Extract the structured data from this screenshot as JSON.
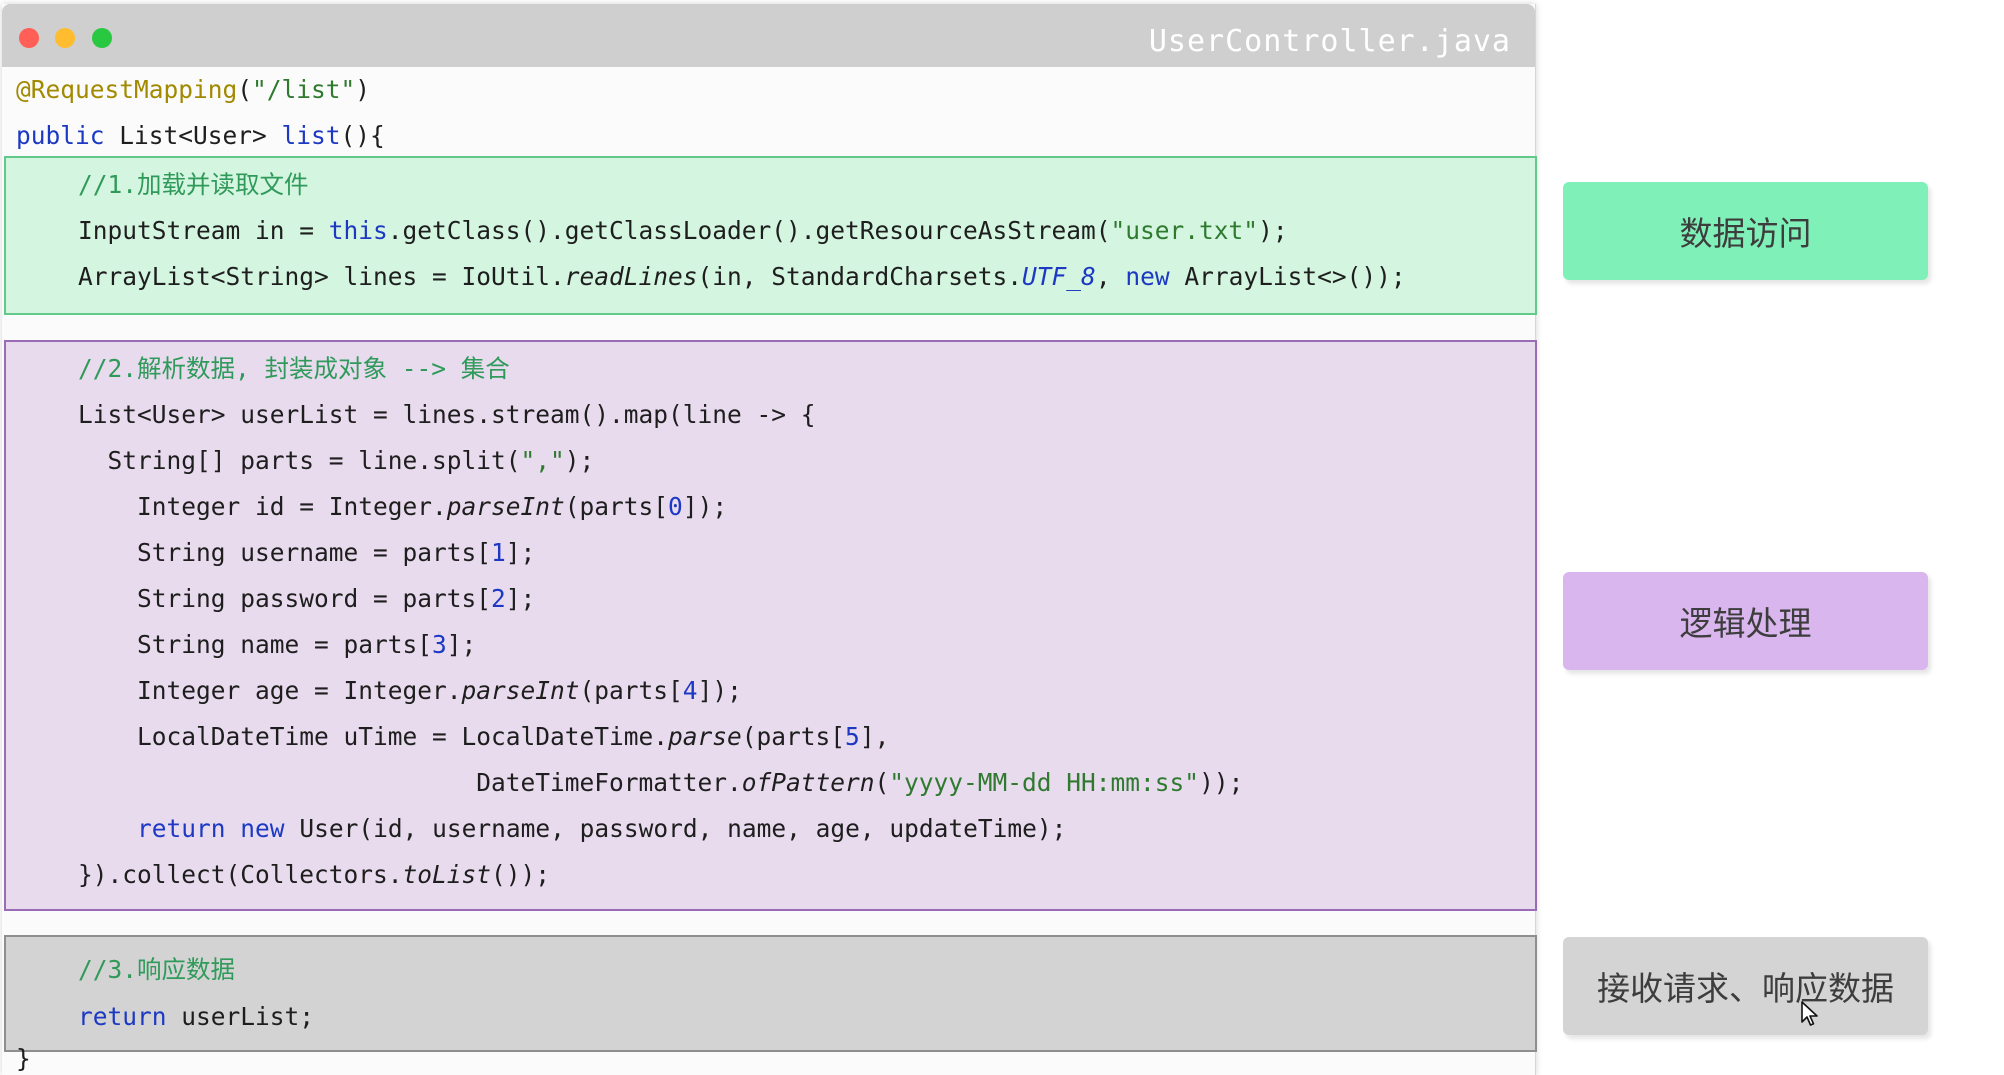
{
  "window": {
    "title": "UserController.java"
  },
  "code": {
    "header": [
      [
        {
          "t": "@RequestMapping",
          "c": "ann"
        },
        {
          "t": "(",
          "c": ""
        },
        {
          "t": "\"/list\"",
          "c": "str"
        },
        {
          "t": ")",
          "c": ""
        }
      ],
      [
        {
          "t": "public",
          "c": "kw"
        },
        {
          "t": " List<User> ",
          "c": ""
        },
        {
          "t": "list",
          "c": "kw"
        },
        {
          "t": "(){",
          "c": ""
        }
      ]
    ],
    "block1": [
      [
        {
          "t": "//1.加载并读取文件",
          "c": "cmt"
        }
      ],
      [
        {
          "t": "InputStream in = ",
          "c": ""
        },
        {
          "t": "this",
          "c": "kw"
        },
        {
          "t": ".getClass().getClassLoader().getResourceAsStream(",
          "c": ""
        },
        {
          "t": "\"user.txt\"",
          "c": "str"
        },
        {
          "t": ");",
          "c": ""
        }
      ],
      [
        {
          "t": "ArrayList<String> lines = IoUtil.",
          "c": ""
        },
        {
          "t": "readLines",
          "c": "it"
        },
        {
          "t": "(in, StandardCharsets.",
          "c": ""
        },
        {
          "t": "UTF_8",
          "c": "it kw"
        },
        {
          "t": ", ",
          "c": ""
        },
        {
          "t": "new",
          "c": "kw"
        },
        {
          "t": " ArrayList<>());",
          "c": ""
        }
      ]
    ],
    "block2": [
      [
        {
          "t": "//2.解析数据, 封装成对象 --> 集合",
          "c": "cmt"
        }
      ],
      [
        {
          "t": "List<User> userList = lines.stream().map(line -> {",
          "c": ""
        }
      ],
      [
        {
          "t": "  String[] parts = line.split(",
          "c": ""
        },
        {
          "t": "\",\"",
          "c": "str"
        },
        {
          "t": ");",
          "c": ""
        }
      ],
      [
        {
          "t": "    Integer id = Integer.",
          "c": ""
        },
        {
          "t": "parseInt",
          "c": "it"
        },
        {
          "t": "(parts[",
          "c": ""
        },
        {
          "t": "0",
          "c": "num"
        },
        {
          "t": "]);",
          "c": ""
        }
      ],
      [
        {
          "t": "    String username = parts[",
          "c": ""
        },
        {
          "t": "1",
          "c": "num"
        },
        {
          "t": "];",
          "c": ""
        }
      ],
      [
        {
          "t": "    String password = parts[",
          "c": ""
        },
        {
          "t": "2",
          "c": "num"
        },
        {
          "t": "];",
          "c": ""
        }
      ],
      [
        {
          "t": "    String name = parts[",
          "c": ""
        },
        {
          "t": "3",
          "c": "num"
        },
        {
          "t": "];",
          "c": ""
        }
      ],
      [
        {
          "t": "    Integer age = Integer.",
          "c": ""
        },
        {
          "t": "parseInt",
          "c": "it"
        },
        {
          "t": "(parts[",
          "c": ""
        },
        {
          "t": "4",
          "c": "num"
        },
        {
          "t": "]);",
          "c": ""
        }
      ],
      [
        {
          "t": "    LocalDateTime uTime = LocalDateTime.",
          "c": ""
        },
        {
          "t": "parse",
          "c": "it"
        },
        {
          "t": "(parts[",
          "c": ""
        },
        {
          "t": "5",
          "c": "num"
        },
        {
          "t": "],",
          "c": ""
        }
      ],
      [
        {
          "t": "                           DateTimeFormatter.",
          "c": ""
        },
        {
          "t": "ofPattern",
          "c": "it"
        },
        {
          "t": "(",
          "c": ""
        },
        {
          "t": "\"yyyy-MM-dd HH:mm:ss\"",
          "c": "str"
        },
        {
          "t": "));",
          "c": ""
        }
      ],
      [
        {
          "t": "    ",
          "c": ""
        },
        {
          "t": "return",
          "c": "kw"
        },
        {
          "t": " ",
          "c": ""
        },
        {
          "t": "new",
          "c": "kw"
        },
        {
          "t": " User(id, username, password, name, age, updateTime);",
          "c": ""
        }
      ],
      [
        {
          "t": "}).collect(Collectors.",
          "c": ""
        },
        {
          "t": "toList",
          "c": "it"
        },
        {
          "t": "());",
          "c": ""
        }
      ]
    ],
    "block3": [
      [
        {
          "t": "//3.响应数据",
          "c": "cmt"
        }
      ],
      [
        {
          "t": "return",
          "c": "kw"
        },
        {
          "t": " userList;",
          "c": ""
        }
      ]
    ],
    "footer": [
      [
        {
          "t": "}",
          "c": ""
        }
      ]
    ]
  },
  "labels": {
    "data_access": "数据访问",
    "logic": "逻辑处理",
    "request": "接收请求、响应数据"
  },
  "colors": {
    "green_block": "#d4f5e0",
    "purple_block": "#e8dbee",
    "gray_block": "#d3d3d3"
  },
  "icons": [
    "mouse-cursor-icon"
  ]
}
